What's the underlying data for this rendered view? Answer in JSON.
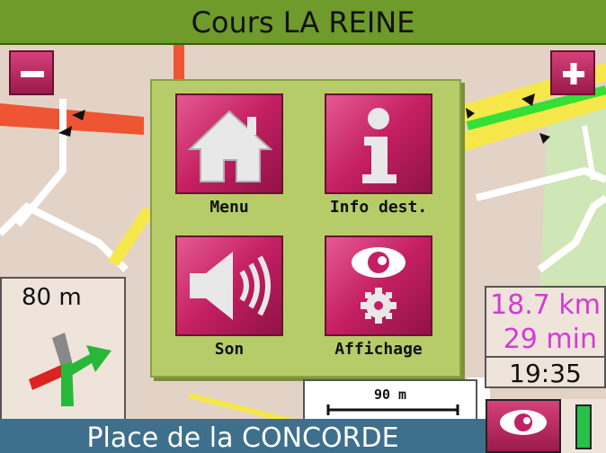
{
  "street": {
    "current": "Cours LA REINE",
    "next": "Place de la CONCORDE"
  },
  "zoom": {
    "out_label": "−",
    "in_label": "+"
  },
  "menu": {
    "items": [
      {
        "label": "Menu",
        "icon": "home-icon"
      },
      {
        "label": "Info dest.",
        "icon": "info-icon"
      },
      {
        "label": "Son",
        "icon": "speaker-icon"
      },
      {
        "label": "Affichage",
        "icon": "eye-gear-icon"
      }
    ]
  },
  "maneuver": {
    "distance": "80 m",
    "icon": "turn-right-icon"
  },
  "trip": {
    "remaining_distance": "18.7 km",
    "remaining_time": "29 min",
    "clock": "19:35"
  },
  "scale": {
    "label": "90 m"
  },
  "view_button": {
    "icon": "eye-icon"
  },
  "gps_signal": {
    "icon": "signal-bar-icon",
    "level": 1.0
  },
  "colors": {
    "accent": "#c41f62",
    "header": "#6f9a2c",
    "footer": "#3e6f8c",
    "info_text": "#d43bd4"
  }
}
